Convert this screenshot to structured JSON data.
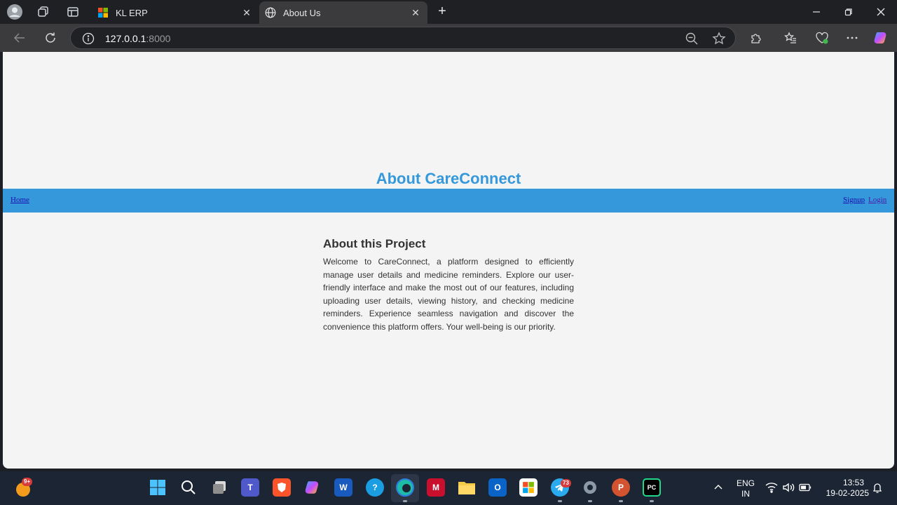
{
  "browser": {
    "tabs": [
      {
        "title": "KL ERP",
        "active": false,
        "favicon": "microsoft-grid-icon"
      },
      {
        "title": "About Us",
        "active": true,
        "favicon": "globe-icon"
      }
    ],
    "address": {
      "host": "127.0.0.1",
      "port": ":8000"
    }
  },
  "page": {
    "heading": "About CareConnect",
    "nav": {
      "home": "Home",
      "signup": "Signup",
      "login": "Login"
    },
    "section_title": "About this Project",
    "section_body": "Welcome to CareConnect, a platform designed to efficiently manage user details and medicine reminders. Explore our user-friendly interface and make the most out of our features, including uploading user details, viewing history, and checking medicine reminders. Experience seamless navigation and discover the convenience this platform offers. Your well-being is our priority."
  },
  "taskbar": {
    "widget_badge": "9+",
    "telegram_badge": "73",
    "pycharm_label": "PC",
    "language": {
      "line1": "ENG",
      "line2": "IN"
    },
    "time": "13:53",
    "date": "19-02-2025"
  },
  "colors": {
    "accent": "#3598db",
    "page_bg": "#f4f4f4",
    "text": "#333333"
  }
}
